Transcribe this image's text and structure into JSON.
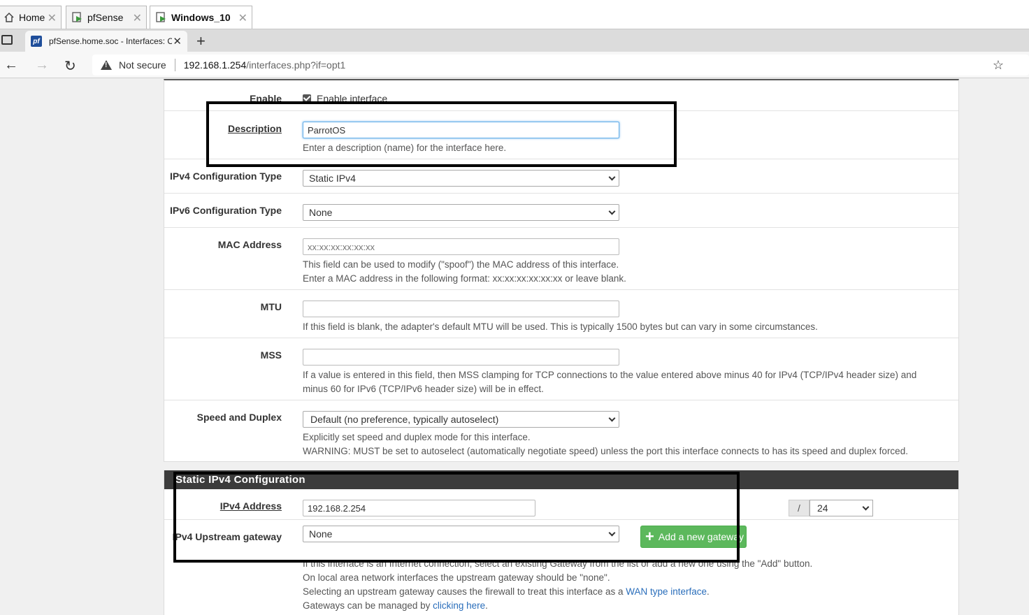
{
  "vm_tabs": [
    {
      "label": "Home"
    },
    {
      "label": "pfSense"
    },
    {
      "label": "Windows_10"
    }
  ],
  "browser_tab": {
    "title": "pfSense.home.soc - Interfaces: O",
    "favicon": "pf"
  },
  "address_bar": {
    "security": "Not secure",
    "host": "192.168.1.254",
    "path": "/interfaces.php?if=opt1"
  },
  "form": {
    "enable": {
      "label": "Enable",
      "checkbox_label": "Enable interface",
      "checked": true
    },
    "description": {
      "label": "Description",
      "value": "ParrotOS",
      "help": "Enter a description (name) for the interface here."
    },
    "ipv4_type": {
      "label": "IPv4 Configuration Type",
      "value": "Static IPv4"
    },
    "ipv6_type": {
      "label": "IPv6 Configuration Type",
      "value": "None"
    },
    "mac": {
      "label": "MAC Address",
      "placeholder": "xx:xx:xx:xx:xx:xx",
      "help1": "This field can be used to modify (\"spoof\") the MAC address of this interface.",
      "help2": "Enter a MAC address in the following format: xx:xx:xx:xx:xx:xx or leave blank."
    },
    "mtu": {
      "label": "MTU",
      "value": "",
      "help": "If this field is blank, the adapter's default MTU will be used. This is typically 1500 bytes but can vary in some circumstances."
    },
    "mss": {
      "label": "MSS",
      "value": "",
      "help1": "If a value is entered in this field, then MSS clamping for TCP connections to the value entered above minus 40 for IPv4 (TCP/IPv4 header size) and",
      "help2": "minus 60 for IPv6 (TCP/IPv6 header size) will be in effect."
    },
    "speed": {
      "label": "Speed and Duplex",
      "value": "Default (no preference, typically autoselect)",
      "help1": "Explicitly set speed and duplex mode for this interface.",
      "help2": "WARNING: MUST be set to autoselect (automatically negotiate speed) unless the port this interface connects to has its speed and duplex forced."
    }
  },
  "static_ipv4": {
    "heading": "Static IPv4 Configuration",
    "address": {
      "label": "IPv4 Address",
      "value": "192.168.2.254",
      "slash": "/",
      "cidr": "24"
    },
    "gateway": {
      "label": "IPv4 Upstream gateway",
      "value": "None",
      "add_button": "Add a new gateway",
      "help1": "If this interface is an Internet connection, select an existing Gateway from the list or add a new one using the \"Add\" button.",
      "help2": "On local area network interfaces the upstream gateway should be \"none\".",
      "help3_pre": "Selecting an upstream gateway causes the firewall to treat this interface as a ",
      "help3_link": "WAN type interface",
      "help3_post": ".",
      "help4_pre": "Gateways can be managed by ",
      "help4_link": "clicking here",
      "help4_post": "."
    }
  }
}
